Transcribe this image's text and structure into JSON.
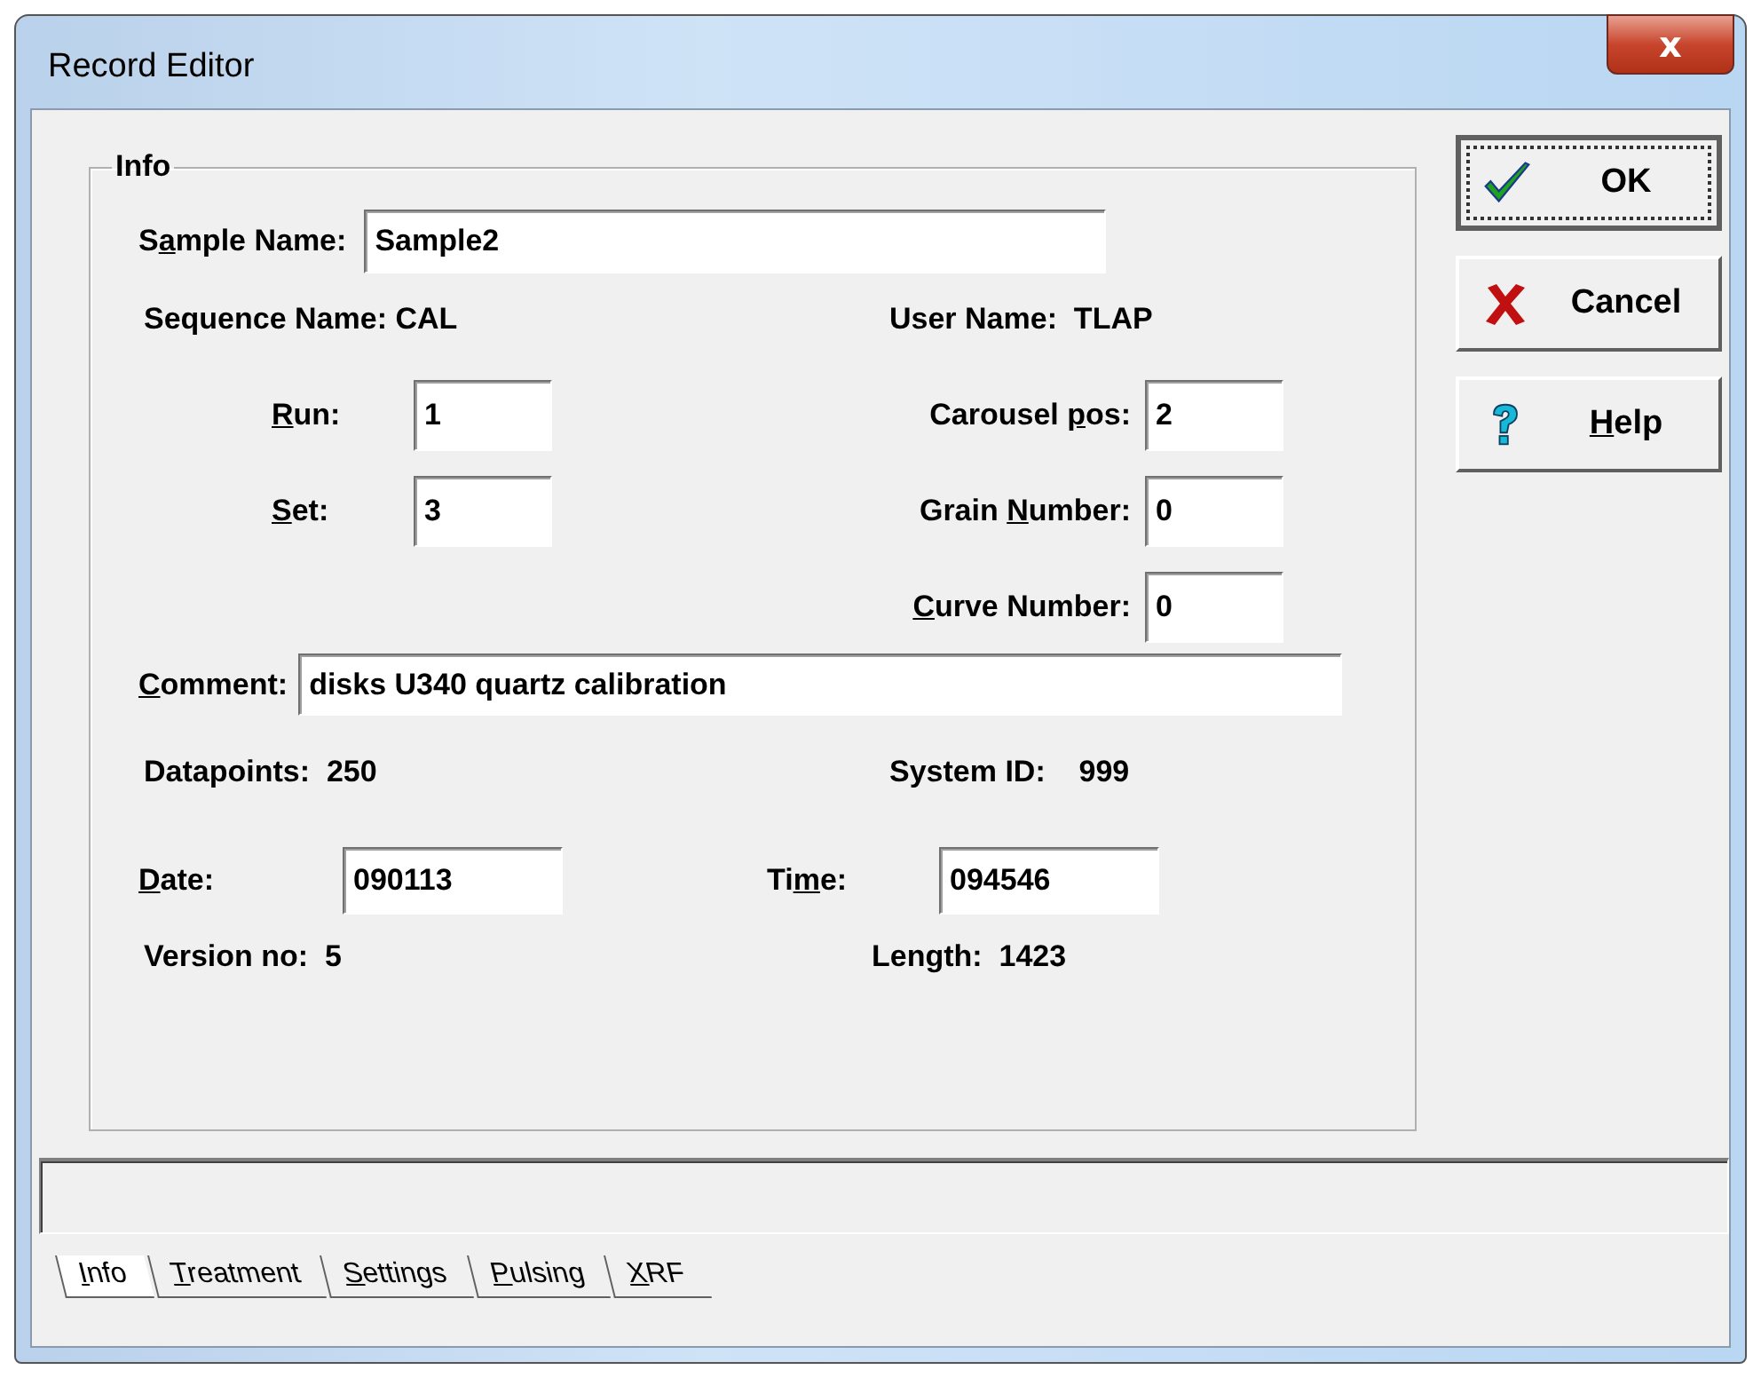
{
  "window": {
    "title": "Record Editor",
    "close": "x"
  },
  "group": {
    "title": "Info"
  },
  "sample_name": {
    "label": {
      "pre": "S",
      "key": "a",
      "post": "mple Name:"
    },
    "value": "Sample2"
  },
  "sequence_name": "Sequence Name: CAL",
  "user_name": "User Name:  TLAP",
  "left_fields": [
    {
      "label": {
        "key": "R",
        "post": "un:"
      },
      "value": "1"
    },
    {
      "label": {
        "key": "S",
        "post": "et:"
      },
      "value": "3"
    }
  ],
  "right_fields": [
    {
      "label": {
        "pre": "Carousel ",
        "key": "p",
        "post": "os:"
      },
      "value": "2"
    },
    {
      "label": {
        "pre": "Grain ",
        "key": "N",
        "post": "umber:"
      },
      "value": "0"
    },
    {
      "label": {
        "key": "C",
        "post": "urve Number:"
      },
      "value": "0"
    }
  ],
  "comment": {
    "label": {
      "key": "C",
      "post": "omment:"
    },
    "value": "disks U340 quartz calibration"
  },
  "datapoints": "Datapoints:  250",
  "system_id": "System ID:    999",
  "date": {
    "label": {
      "key": "D",
      "post": "ate:"
    },
    "value": "090113"
  },
  "time": {
    "label": {
      "pre": "Ti",
      "key": "m",
      "post": "e:"
    },
    "value": "094546"
  },
  "version": "Version no:  5",
  "length": "Length:  1423",
  "buttons": [
    {
      "kind": "ok",
      "label": {
        "post": "OK"
      },
      "focused": true
    },
    {
      "kind": "cancel",
      "label": {
        "post": "Cancel"
      },
      "focused": false
    },
    {
      "kind": "help",
      "label": {
        "key": "H",
        "post": "elp"
      },
      "focused": false
    }
  ],
  "tabs": [
    {
      "label": {
        "key": "I",
        "post": "nfo"
      },
      "selected": true
    },
    {
      "label": {
        "key": "T",
        "post": "reatment"
      },
      "selected": false
    },
    {
      "label": {
        "key": "S",
        "post": "ettings"
      },
      "selected": false
    },
    {
      "label": {
        "key": "P",
        "post": "ulsing"
      },
      "selected": false
    },
    {
      "label": {
        "key": "X",
        "post": "RF"
      },
      "selected": false
    }
  ]
}
